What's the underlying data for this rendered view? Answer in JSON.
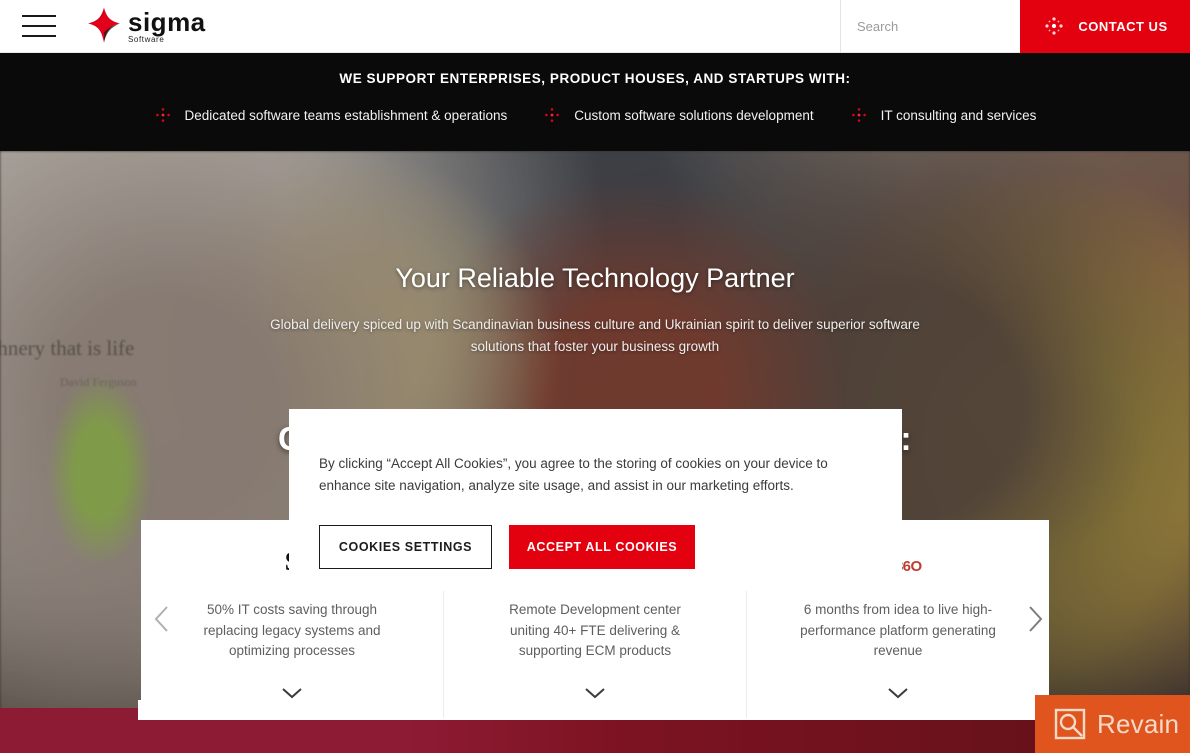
{
  "header": {
    "menu_icon": "hamburger-menu-icon",
    "logo": {
      "name": "sigma",
      "sub": "Software",
      "icon": "sigma-star-logo-icon"
    },
    "search": {
      "placeholder": "Search",
      "value": "",
      "icon": "search-icon"
    },
    "contact": {
      "label": "CONTACT US",
      "icon": "dotted-star-icon",
      "bg": "#e3000f"
    }
  },
  "banner": {
    "title": "WE SUPPORT ENTERPRISES, PRODUCT HOUSES, AND STARTUPS WITH:",
    "bg": "#0a0a0a",
    "items": [
      {
        "label": "Dedicated software teams establishment & operations",
        "icon": "dotted-star-icon"
      },
      {
        "label": "Custom software solutions development",
        "icon": "dotted-star-icon"
      },
      {
        "label": "IT consulting and services",
        "icon": "dotted-star-icon"
      }
    ]
  },
  "hero": {
    "title": "Your Reliable Technology Partner",
    "subtitle": "Global delivery spiced up with Scandinavian business culture and Ukrainian spirit to deliver superior software solutions that foster your business growth",
    "headline": "CUSTOMERS WE ARE REFERRING TO:",
    "wall_quote": "chnery that is life",
    "wall_quote_author": "David Ferguson"
  },
  "carousel": {
    "prev_icon": "chevron-left-icon",
    "next_icon": "chevron-right-icon",
    "cards": [
      {
        "logo_text": "S",
        "logo_type": "text",
        "text": "50% IT costs saving through replacing legacy systems and optimizing processes",
        "expand_icon": "chevron-down-icon"
      },
      {
        "logo_text": "",
        "logo_type": "text",
        "text": "Remote Development center uniting 40+ FTE delivering & supporting ECM products",
        "expand_icon": "chevron-down-icon"
      },
      {
        "logo_text": "360",
        "logo_type": "360",
        "text": "6 months from idea to live high-performance platform generating revenue",
        "expand_icon": "chevron-down-icon"
      }
    ]
  },
  "cookie_banner": {
    "text": "By clicking “Accept All Cookies”, you agree to the storing of cookies on your device to enhance site navigation, analyze site usage, and assist in our marketing efforts.",
    "settings_label": "COOKIES SETTINGS",
    "accept_label": "ACCEPT ALL COOKIES",
    "accept_bg": "#e3000f"
  },
  "revain": {
    "label": "Revain",
    "icon": "revain-logo-icon",
    "bg": "#e0551e"
  }
}
